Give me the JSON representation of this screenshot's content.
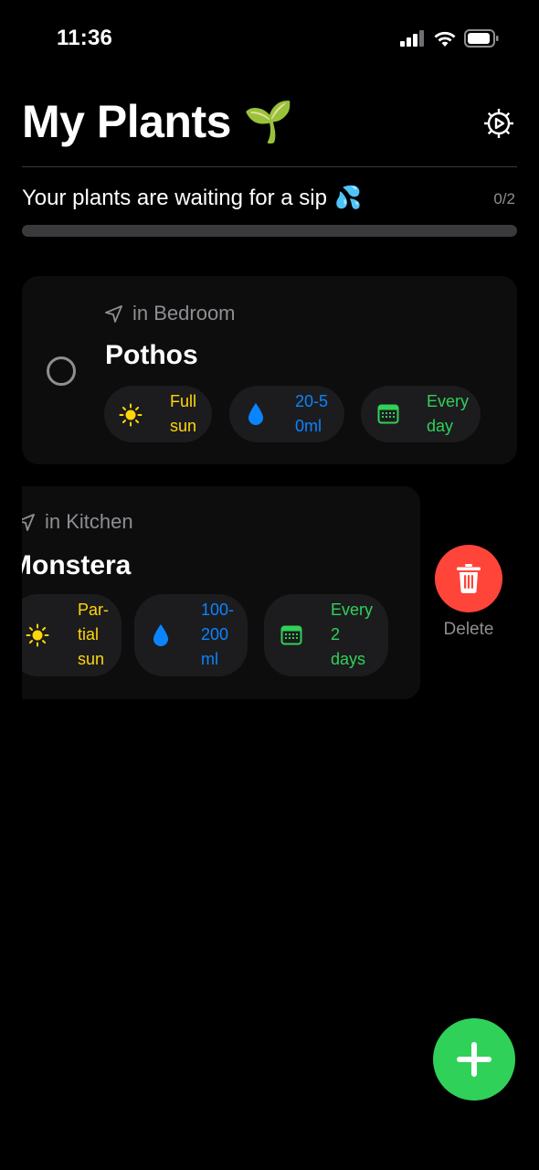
{
  "status_bar": {
    "time": "11:36"
  },
  "header": {
    "title": "My Plants",
    "title_emoji": "🌱"
  },
  "progress": {
    "message": "Your plants are waiting for a sip",
    "emoji": "💦",
    "count_text": "0/2",
    "fraction": 0
  },
  "plants": [
    {
      "location": "in Bedroom",
      "name": "Pothos",
      "sun": [
        "Full",
        "sun"
      ],
      "water": [
        "20-5",
        "0ml"
      ],
      "schedule": [
        "Every",
        "day"
      ]
    },
    {
      "location": "in Kitchen",
      "name": "Monstera",
      "sun": [
        "Par-",
        "tial",
        "sun"
      ],
      "water": [
        "100-",
        "200",
        "ml"
      ],
      "schedule": [
        "Every",
        "2",
        "days"
      ]
    }
  ],
  "swipe_action": {
    "label": "Delete"
  },
  "colors": {
    "accent": "#30d158",
    "sun": "#ffd60a",
    "water": "#0a84ff",
    "delete": "#ff453a"
  },
  "icons": [
    "signal-icon",
    "wifi-icon",
    "battery-icon",
    "gear-icon",
    "location-arrow-icon",
    "sun-icon",
    "water-drop-icon",
    "calendar-icon",
    "trash-icon",
    "plus-icon"
  ]
}
